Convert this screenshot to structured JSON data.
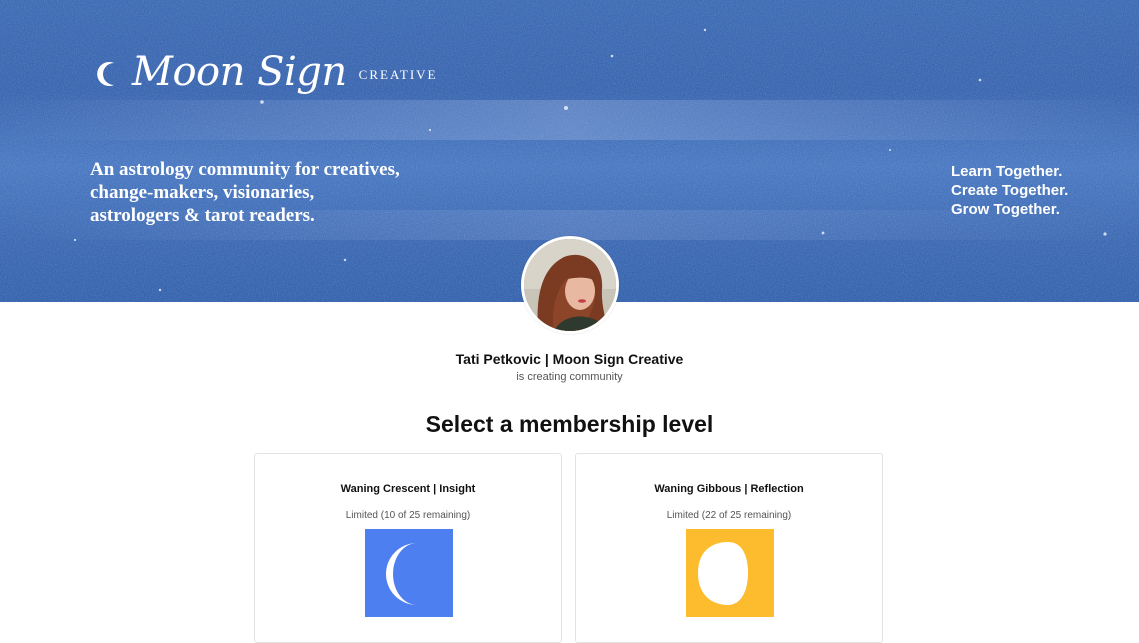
{
  "banner": {
    "logo_script": "Moon Sign",
    "logo_sub": "CREATIVE",
    "tagline_lines": [
      "An astrology community for creatives,",
      "change-makers, visionaries,",
      "astrologers & tarot readers."
    ],
    "motto_lines": [
      "Learn Together.",
      "Create Together.",
      "Grow Together."
    ]
  },
  "creator": {
    "name": "Tati Petkovic | Moon Sign Creative",
    "status": "is creating community"
  },
  "membership": {
    "title": "Select a membership level",
    "tiers": [
      {
        "name": "Waning Crescent | Insight",
        "limit": "Limited (10 of 25 remaining)",
        "icon": "waning-crescent-moon-icon",
        "bg_color": "#4e7ff0"
      },
      {
        "name": "Waning Gibbous | Reflection",
        "limit": "Limited (22 of 25 remaining)",
        "icon": "waning-gibbous-moon-icon",
        "bg_color": "#fcbc2e"
      }
    ]
  },
  "colors": {
    "banner_blue": "#3d6bb4",
    "text_dark": "#111111",
    "text_muted": "#555555",
    "card_border": "#e3e3e3"
  }
}
